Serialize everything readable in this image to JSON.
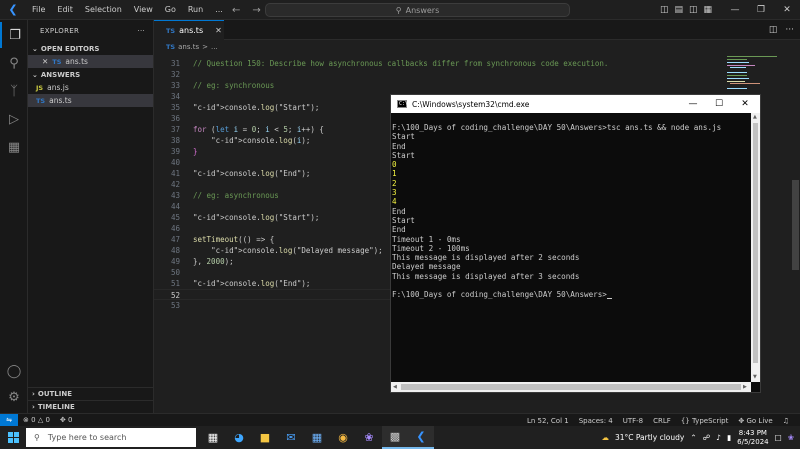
{
  "titlebar": {
    "menu": [
      "File",
      "Edit",
      "Selection",
      "View",
      "Go",
      "Run",
      "..."
    ],
    "search_label": "Answers"
  },
  "sidebar": {
    "title": "EXPLORER",
    "open_editors_label": "OPEN EDITORS",
    "open_editor_file": "ans.ts",
    "folder_label": "ANSWERS",
    "files": [
      {
        "badge": "JS",
        "name": "ans.js"
      },
      {
        "badge": "TS",
        "name": "ans.ts"
      }
    ],
    "outline_label": "OUTLINE",
    "timeline_label": "TIMELINE"
  },
  "editor": {
    "tab_label": "ans.ts",
    "tab_badge": "TS",
    "breadcrumb_file": "ans.ts",
    "breadcrumb_sep": ">",
    "breadcrumb_more": "...",
    "lines": [
      {
        "n": "31",
        "text": "// Question 150: Describe how asynchronous callbacks differ from synchronous code execution."
      },
      {
        "n": "32",
        "text": ""
      },
      {
        "n": "33",
        "text": "// eg: synchronous"
      },
      {
        "n": "34",
        "text": ""
      },
      {
        "n": "35",
        "text": "console.log(\"Start\");"
      },
      {
        "n": "36",
        "text": ""
      },
      {
        "n": "37",
        "text": "for (let i = 0; i < 5; i++) {"
      },
      {
        "n": "38",
        "text": "    console.log(i);"
      },
      {
        "n": "39",
        "text": "}"
      },
      {
        "n": "40",
        "text": ""
      },
      {
        "n": "41",
        "text": "console.log(\"End\");"
      },
      {
        "n": "42",
        "text": ""
      },
      {
        "n": "43",
        "text": "// eg: asynchronous"
      },
      {
        "n": "44",
        "text": ""
      },
      {
        "n": "45",
        "text": "console.log(\"Start\");"
      },
      {
        "n": "46",
        "text": ""
      },
      {
        "n": "47",
        "text": "setTimeout(() => {"
      },
      {
        "n": "48",
        "text": "    console.log(\"Delayed message\");"
      },
      {
        "n": "49",
        "text": "}, 2000);"
      },
      {
        "n": "50",
        "text": ""
      },
      {
        "n": "51",
        "text": "console.log(\"End\");"
      },
      {
        "n": "52",
        "text": ""
      },
      {
        "n": "53",
        "text": ""
      }
    ]
  },
  "cmd": {
    "title": "C:\\Windows\\system32\\cmd.exe",
    "lines": [
      {
        "text": "F:\\100_Days of coding_challenge\\DAY 50\\Answers>tsc ans.ts && node ans.js",
        "color": "default"
      },
      {
        "text": "Start",
        "color": "default"
      },
      {
        "text": "End",
        "color": "default"
      },
      {
        "text": "Start",
        "color": "default"
      },
      {
        "text": "0",
        "color": "yellow"
      },
      {
        "text": "1",
        "color": "yellow"
      },
      {
        "text": "2",
        "color": "yellow"
      },
      {
        "text": "3",
        "color": "yellow"
      },
      {
        "text": "4",
        "color": "yellow"
      },
      {
        "text": "End",
        "color": "default"
      },
      {
        "text": "Start",
        "color": "default"
      },
      {
        "text": "End",
        "color": "default"
      },
      {
        "text": "Timeout 1 - 0ms",
        "color": "default"
      },
      {
        "text": "Timeout 2 - 100ms",
        "color": "default"
      },
      {
        "text": "This message is displayed after 2 seconds",
        "color": "default"
      },
      {
        "text": "Delayed message",
        "color": "default"
      },
      {
        "text": "This message is displayed after 3 seconds",
        "color": "default"
      },
      {
        "text": "",
        "color": "default"
      },
      {
        "text": "F:\\100_Days of coding_challenge\\DAY 50\\Answers>",
        "color": "default"
      }
    ]
  },
  "statusbar": {
    "errors": "0",
    "warnings": "0",
    "ports": "0",
    "position": "Ln 52, Col 1",
    "spaces": "Spaces: 4",
    "encoding": "UTF-8",
    "eol": "CRLF",
    "language": "TypeScript",
    "golive": "Go Live"
  },
  "taskbar": {
    "search_placeholder": "Type here to search",
    "weather": "31°C  Partly cloudy",
    "time": "8:43 PM",
    "date": "6/5/2024"
  },
  "colors": {
    "accent": "#0078d4",
    "editor_bg": "#1f1f1f",
    "terminal_bg": "#0c0c0c"
  }
}
